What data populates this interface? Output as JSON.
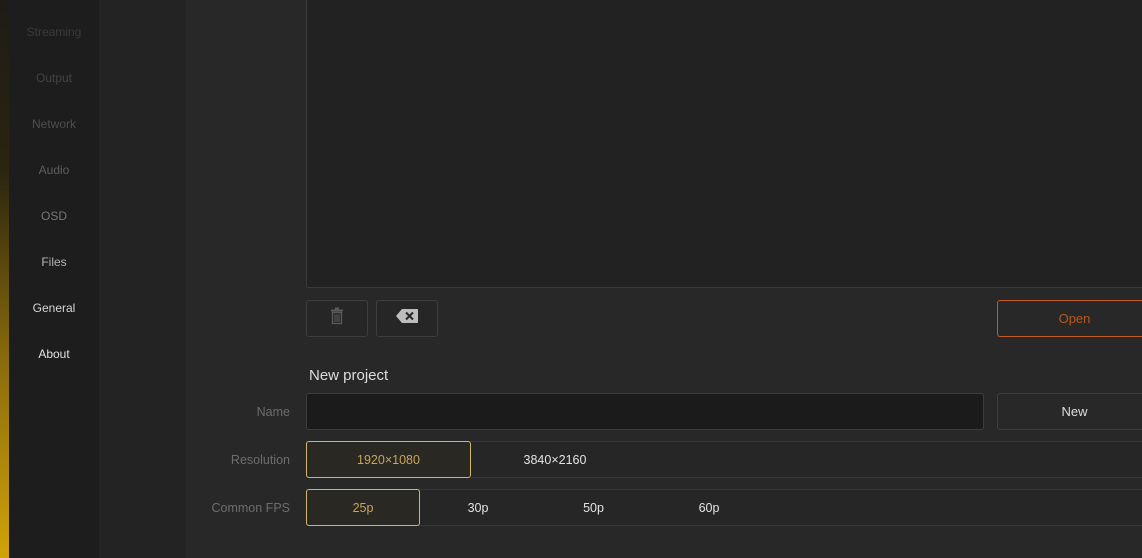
{
  "sidebar": {
    "items": [
      {
        "label": "Streaming",
        "color": "#3a3a3a"
      },
      {
        "label": "Output",
        "color": "#444444"
      },
      {
        "label": "Network",
        "color": "#4e4e4e"
      },
      {
        "label": "Audio",
        "color": "#5e5e5e"
      },
      {
        "label": "OSD",
        "color": "#767676"
      },
      {
        "label": "Files",
        "color": "#b5b5b5"
      },
      {
        "label": "General",
        "color": "#d6d6d6"
      },
      {
        "label": "About",
        "color": "#e2e2e2"
      }
    ]
  },
  "files": {
    "toolbar": {
      "delete_icon": "trash-icon",
      "clear_icon": "backspace-icon",
      "open_label": "Open"
    }
  },
  "new_project": {
    "title": "New project",
    "name": {
      "label": "Name",
      "value": "",
      "placeholder": ""
    },
    "new_label": "New",
    "resolution": {
      "label": "Resolution",
      "options": [
        "1920×1080",
        "3840×2160"
      ],
      "selected": "1920×1080"
    },
    "fps": {
      "label": "Common FPS",
      "options": [
        "25p",
        "30p",
        "50p",
        "60p"
      ],
      "selected": "25p"
    }
  },
  "colors": {
    "accent_selected": "#d2b46e",
    "open_accent": "#c35a1e",
    "sidebar_accent": "#d1a20a"
  }
}
